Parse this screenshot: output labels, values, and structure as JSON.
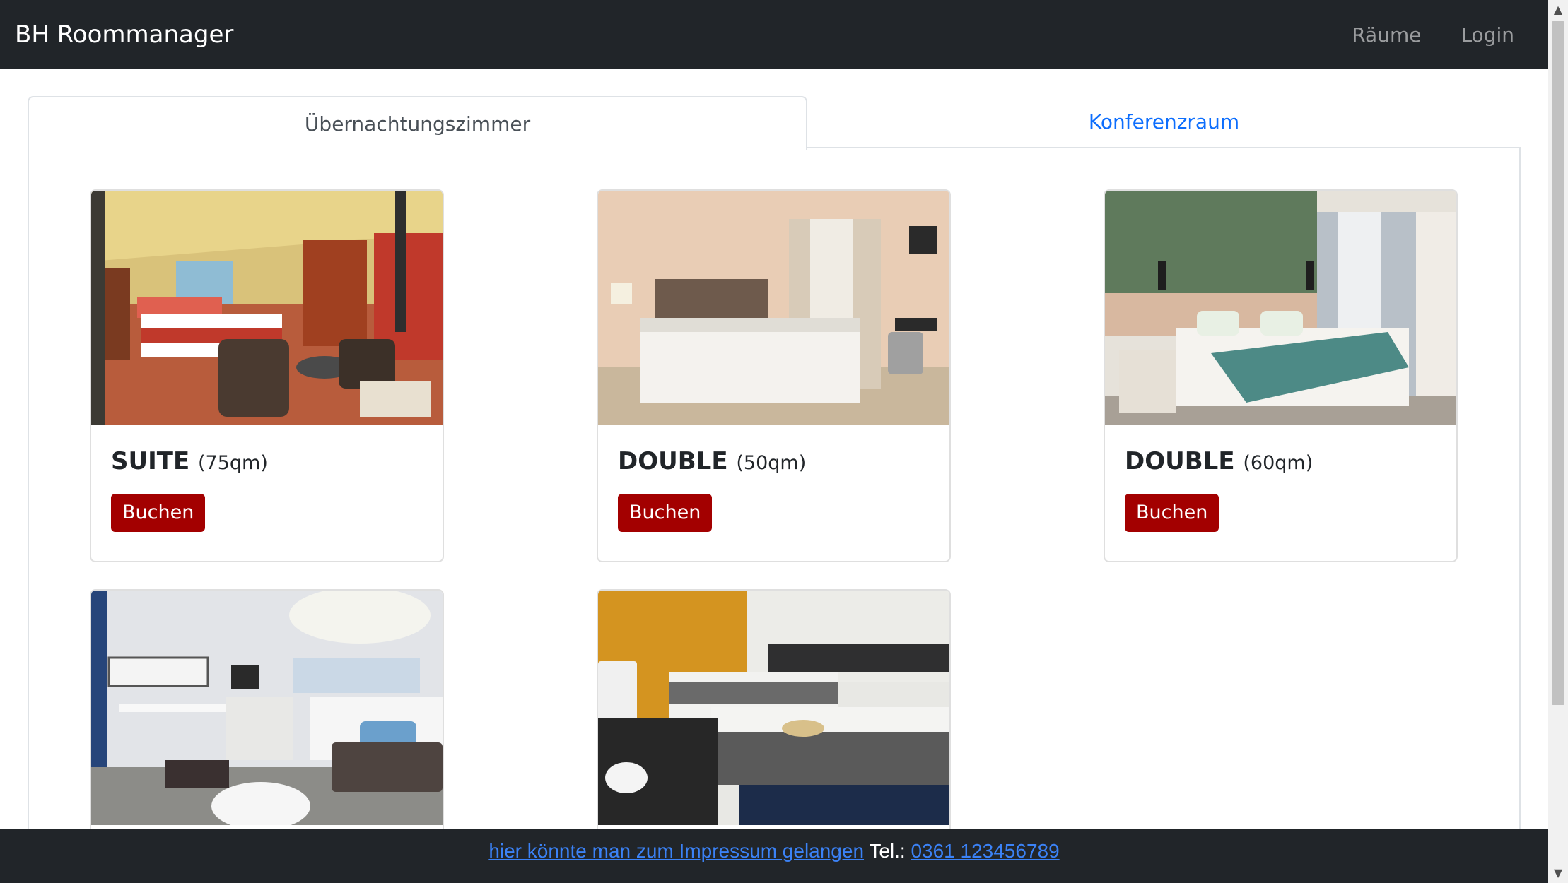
{
  "navbar": {
    "brand": "BH Roommanager",
    "links": [
      "Räume",
      "Login"
    ]
  },
  "tabs": [
    {
      "label": "Übernachtungszimmer",
      "active": true
    },
    {
      "label": "Konferenzraum",
      "active": false
    }
  ],
  "rooms": [
    {
      "type": "SUITE",
      "size": "(75qm)",
      "button": "Buchen",
      "photo": "suite-room-photo"
    },
    {
      "type": "DOUBLE",
      "size": "(50qm)",
      "button": "Buchen",
      "photo": "double-room-photo"
    },
    {
      "type": "DOUBLE",
      "size": "(60qm)",
      "button": "Buchen",
      "photo": "double-room-photo"
    },
    {
      "type": "",
      "size": "",
      "button": "",
      "photo": "room-photo"
    },
    {
      "type": "",
      "size": "",
      "button": "",
      "photo": "twin-room-photo"
    }
  ],
  "footer": {
    "impressum_link": "hier könnte man zum Impressum gelangen",
    "tel_label": "Tel.:",
    "tel_link": "0361 123456789"
  },
  "colors": {
    "navbar_bg": "#212529",
    "book_button": "#a30000",
    "link": "#0d6efd"
  }
}
